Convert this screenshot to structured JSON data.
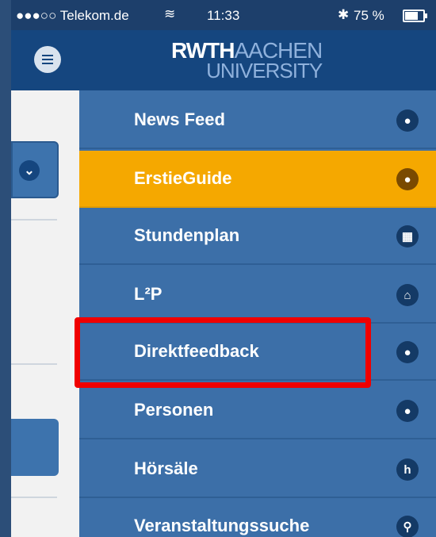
{
  "status_bar": {
    "carrier": "●●●○○ Telekom.de",
    "time": "11:33",
    "battery": "75 %"
  },
  "logo": {
    "rwth": "RWTH",
    "aachen": "AACHEN",
    "university": "UNIVERSITY"
  },
  "menu": {
    "items": [
      {
        "label": "News Feed",
        "icon": "speech-bubble-icon"
      },
      {
        "label": "ErstieGuide",
        "icon": "speech-bubble-icon"
      },
      {
        "label": "Stundenplan",
        "icon": "calendar-icon"
      },
      {
        "label": "L²P",
        "icon": "home-icon"
      },
      {
        "label": "Direktfeedback",
        "icon": "person-icon"
      },
      {
        "label": "Personen",
        "icon": "person-icon"
      },
      {
        "label": "Hörsäle",
        "icon": "h-icon"
      },
      {
        "label": "Veranstaltungssuche",
        "icon": "search-icon"
      }
    ]
  },
  "colors": {
    "menu_bg": "#3c6fa8",
    "active": "#f5a800",
    "header": "#15467f",
    "highlight": "#f00000"
  }
}
